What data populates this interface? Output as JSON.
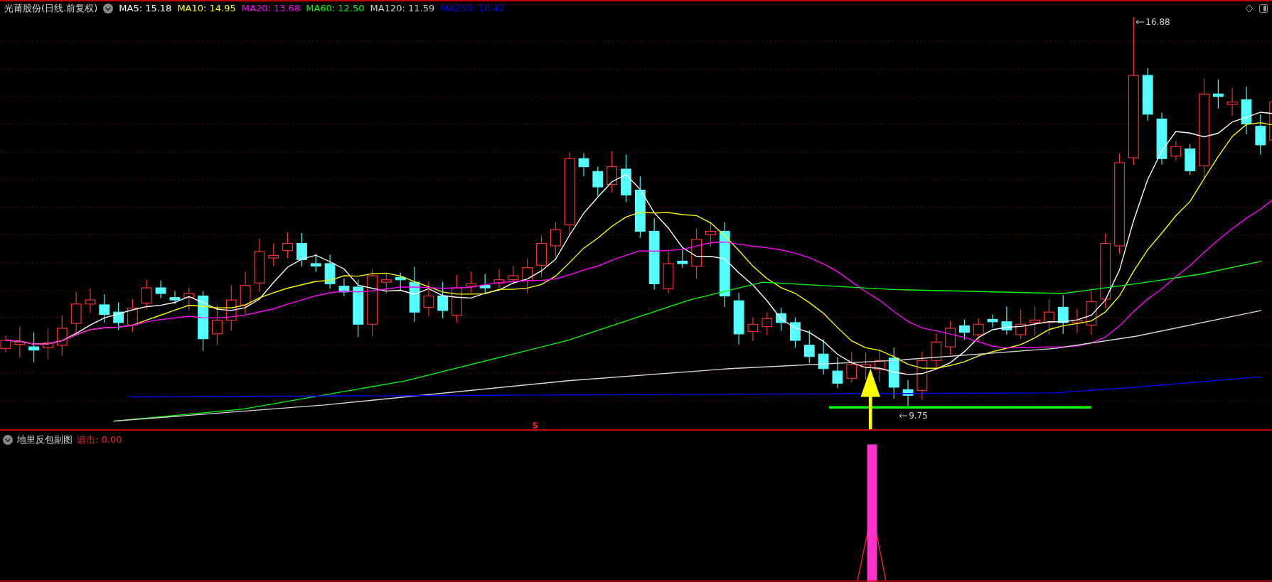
{
  "header": {
    "title": "光莆股份(日线.前复权)",
    "ma_readings": [
      {
        "label": "MA5: 15.18",
        "color": "#ffffff"
      },
      {
        "label": "MA10: 14.95",
        "color": "#ffff00"
      },
      {
        "label": "MA20: 13.68",
        "color": "#ff00ff"
      },
      {
        "label": "MA60: 12.50",
        "color": "#00ff00"
      },
      {
        "label": "MA120: 11.59",
        "color": "#d0d0d0"
      },
      {
        "label": "MA250: 10.42",
        "color": "#0000ff"
      }
    ]
  },
  "main_chart": {
    "high_label": "16.88",
    "low_label": "9.75",
    "signal_mark": "S"
  },
  "sub_panel": {
    "title": "地里反包副图",
    "reading": "追击: 0.00"
  }
}
